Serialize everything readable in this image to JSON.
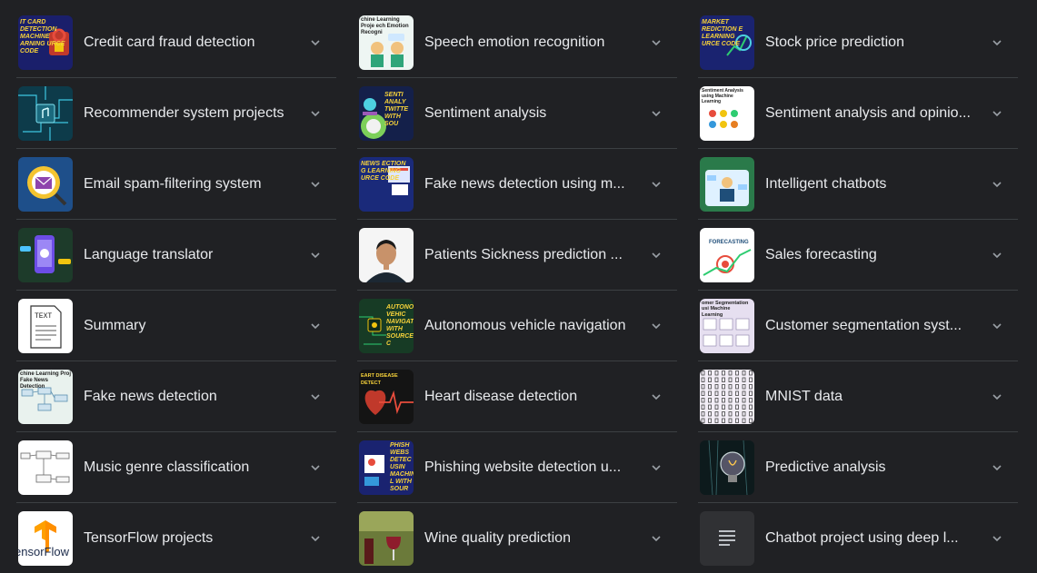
{
  "columns": [
    {
      "items": [
        {
          "label": "Credit card fraud detection",
          "icon": "credit-card-fraud-thumbnail",
          "caption": "IT CARD DETECTION MACHINE ARNING URCE CODE"
        },
        {
          "label": "Recommender system projects",
          "icon": "circuit-board-thumbnail"
        },
        {
          "label": "Email spam-filtering system",
          "icon": "email-spam-thumbnail"
        },
        {
          "label": "Language translator",
          "icon": "language-translator-thumbnail"
        },
        {
          "label": "Summary",
          "icon": "text-document-thumbnail",
          "caption": "TEXT"
        },
        {
          "label": "Fake news detection",
          "icon": "fake-news-diagram-thumbnail",
          "caption": "chine Learning Proj Fake News Detection"
        },
        {
          "label": "Music genre classification",
          "icon": "flow-diagram-thumbnail"
        },
        {
          "label": "TensorFlow projects",
          "icon": "tensorflow-logo-thumbnail",
          "caption": "ensorFlow"
        }
      ]
    },
    {
      "items": [
        {
          "label": "Speech emotion recognition",
          "icon": "speech-emotion-thumbnail",
          "caption": "chine Learning Proje ech Emotion Recogni"
        },
        {
          "label": "Sentiment analysis",
          "icon": "sentiment-twitter-thumbnail",
          "caption": "SENTI ANALY TWITTE WITH SOU"
        },
        {
          "label": "Fake news detection using m...",
          "icon": "fake-news-source-code-thumbnail",
          "caption": "NEWS ECTION G LEARNING URCE CODE"
        },
        {
          "label": "Patients Sickness prediction ...",
          "icon": "person-photo-thumbnail"
        },
        {
          "label": "Autonomous vehicle navigation",
          "icon": "autonomous-vehicle-thumbnail",
          "caption": "AUTONOM VEHIC NAVIGATI WITH SOURCE C"
        },
        {
          "label": "Heart disease detection",
          "icon": "heart-disease-thumbnail",
          "caption": "EART DISEASE DETECT"
        },
        {
          "label": "Phishing website detection u...",
          "icon": "phishing-website-thumbnail",
          "caption": "PHISH WEBS DETEC USIN MACHINE L WITH SOUR"
        },
        {
          "label": "Wine quality prediction",
          "icon": "wine-photo-thumbnail"
        }
      ]
    },
    {
      "items": [
        {
          "label": "Stock price prediction",
          "icon": "stock-market-thumbnail",
          "caption": "MARKET REDICTION E LEARNING URCE CODE"
        },
        {
          "label": "Sentiment analysis and opinio...",
          "icon": "sentiment-opinion-thumbnail",
          "caption": "Sentiment Analysis using Machine Learning"
        },
        {
          "label": "Intelligent chatbots",
          "icon": "chatbot-person-thumbnail"
        },
        {
          "label": "Sales forecasting",
          "icon": "forecasting-thumbnail",
          "caption": "FORECASTING"
        },
        {
          "label": "Customer segmentation syst...",
          "icon": "customer-segmentation-thumbnail",
          "caption": "omer Segmentation usi Machine Learning"
        },
        {
          "label": "MNIST data",
          "icon": "mnist-grid-thumbnail"
        },
        {
          "label": "Predictive analysis",
          "icon": "lightbulb-thumbnail"
        },
        {
          "label": "Chatbot project using deep l...",
          "icon": "document-lines-icon"
        }
      ]
    }
  ],
  "chevron_icon": "chevron-down-icon",
  "colors": {
    "background": "#202124",
    "divider": "#3c4043",
    "text": "#e8eaed",
    "chevron": "#9aa0a6"
  }
}
